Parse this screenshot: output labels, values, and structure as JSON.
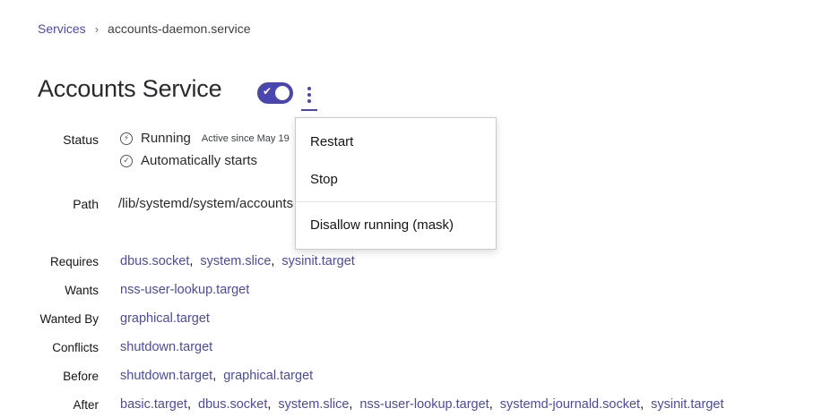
{
  "breadcrumb": {
    "parent": "Services",
    "separator": "›",
    "current": "accounts-daemon.service"
  },
  "header": {
    "title": "Accounts Service",
    "toggle_enabled": true
  },
  "status": {
    "label": "Status",
    "state": "Running",
    "active_since": "Active since May 19",
    "autostart": "Automatically starts"
  },
  "path": {
    "label": "Path",
    "value": "/lib/systemd/system/accounts-daemon.service"
  },
  "dependencies": [
    {
      "label": "Requires",
      "links": [
        "dbus.socket",
        "system.slice",
        "sysinit.target"
      ]
    },
    {
      "label": "Wants",
      "links": [
        "nss-user-lookup.target"
      ]
    },
    {
      "label": "Wanted By",
      "links": [
        "graphical.target"
      ]
    },
    {
      "label": "Conflicts",
      "links": [
        "shutdown.target"
      ]
    },
    {
      "label": "Before",
      "links": [
        "shutdown.target",
        "graphical.target"
      ]
    },
    {
      "label": "After",
      "links": [
        "basic.target",
        "dbus.socket",
        "system.slice",
        "nss-user-lookup.target",
        "systemd-journald.socket",
        "sysinit.target"
      ]
    }
  ],
  "menu": {
    "items": [
      "Restart",
      "Stop"
    ],
    "danger_item": "Disallow running (mask)"
  },
  "icons": {
    "kebab": "kebab-menu-icon",
    "running": "running-icon",
    "autostart": "check-circle-icon",
    "toggle_check": "check-icon"
  },
  "colors": {
    "accent": "#4a46b0",
    "link": "#4b4aa8"
  }
}
